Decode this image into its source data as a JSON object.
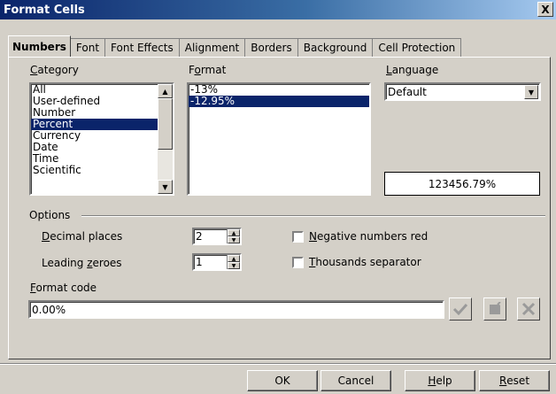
{
  "window": {
    "title": "Format Cells",
    "close_label": "X"
  },
  "tabs": [
    {
      "label": "Numbers",
      "active": true
    },
    {
      "label": "Font"
    },
    {
      "label": "Font Effects"
    },
    {
      "label": "Alignment"
    },
    {
      "label": "Borders"
    },
    {
      "label": "Background"
    },
    {
      "label": "Cell Protection"
    }
  ],
  "category": {
    "label_u": "C",
    "label_rest": "ategory",
    "items": [
      "All",
      "User-defined",
      "Number",
      "Percent",
      "Currency",
      "Date",
      "Time",
      "Scientific"
    ],
    "selected": "Percent"
  },
  "format": {
    "label_pre": "F",
    "label_u": "o",
    "label_rest": "rmat",
    "items": [
      "-13%",
      "-12.95%"
    ],
    "selected": "-12.95%"
  },
  "language": {
    "label_u": "L",
    "label_rest": "anguage",
    "value": "Default"
  },
  "preview_text": "123456.79%",
  "options": {
    "label": "Options",
    "decimal_places": {
      "label_u": "D",
      "label_rest": "ecimal places",
      "value": "2"
    },
    "leading_zeroes": {
      "label_pre": "Leading ",
      "label_u": "z",
      "label_rest": "eroes",
      "value": "1"
    },
    "negative_red": {
      "label_u": "N",
      "label_rest": "egative numbers red",
      "checked": false
    },
    "thousands_sep": {
      "label_u": "T",
      "label_rest": "housands separator",
      "checked": false
    }
  },
  "format_code": {
    "label_u": "F",
    "label_rest": "ormat code",
    "value": "0.00%"
  },
  "icons": {
    "accept": "checkmark-icon",
    "add": "comment-icon",
    "delete": "delete-x-icon"
  },
  "buttons": {
    "ok": "OK",
    "cancel": "Cancel",
    "help_u": "H",
    "help_rest": "elp",
    "reset_u": "R",
    "reset_rest": "eset"
  }
}
